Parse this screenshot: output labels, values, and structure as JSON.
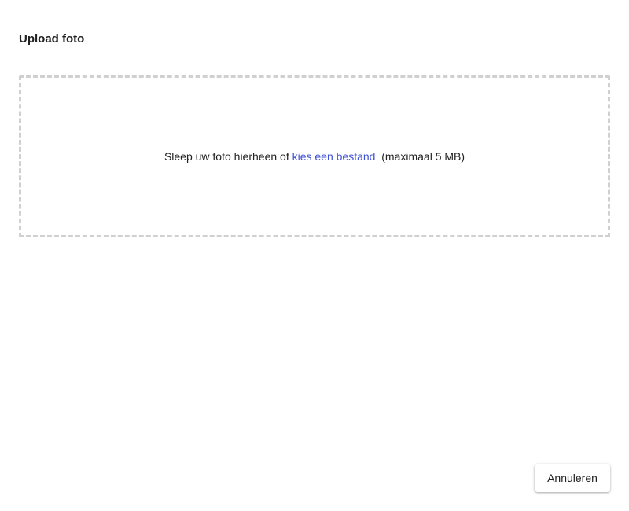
{
  "dialog": {
    "title": "Upload foto"
  },
  "dropzone": {
    "text_before": "Sleep uw foto hierheen of ",
    "link_label": "kies een bestand",
    "text_after": "  (maximaal 5 MB)"
  },
  "actions": {
    "cancel_label": "Annuleren"
  },
  "colors": {
    "link": "#3f51d6",
    "dropzone_border": "#d0d0d0"
  }
}
